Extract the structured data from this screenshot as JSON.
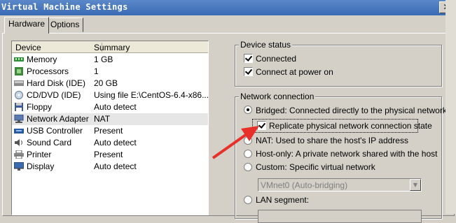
{
  "window": {
    "title": "Virtual Machine Settings",
    "close_label": "✕"
  },
  "tabs": [
    {
      "label": "Hardware",
      "active": true
    },
    {
      "label": "Options",
      "active": false
    }
  ],
  "device_list": {
    "columns": [
      "Device",
      "Summary"
    ],
    "rows": [
      {
        "name": "Memory",
        "summary": "1 GB",
        "icon": "memory-icon"
      },
      {
        "name": "Processors",
        "summary": "1",
        "icon": "processor-icon"
      },
      {
        "name": "Hard Disk (IDE)",
        "summary": "20 GB",
        "icon": "hard-disk-icon"
      },
      {
        "name": "CD/DVD (IDE)",
        "summary": "Using file E:\\CentOS-6.4-x86...",
        "icon": "cd-dvd-icon"
      },
      {
        "name": "Floppy",
        "summary": "Auto detect",
        "icon": "floppy-icon"
      },
      {
        "name": "Network Adapter",
        "summary": "NAT",
        "icon": "network-adapter-icon",
        "selected": true
      },
      {
        "name": "USB Controller",
        "summary": "Present",
        "icon": "usb-icon"
      },
      {
        "name": "Sound Card",
        "summary": "Auto detect",
        "icon": "sound-card-icon"
      },
      {
        "name": "Printer",
        "summary": "Present",
        "icon": "printer-icon"
      },
      {
        "name": "Display",
        "summary": "Auto detect",
        "icon": "display-icon"
      }
    ]
  },
  "device_status": {
    "title": "Device status",
    "connected": {
      "label": "Connected",
      "checked": true
    },
    "connect_at_power_on": {
      "label": "Connect at power on",
      "checked": true
    }
  },
  "network_connection": {
    "title": "Network connection",
    "bridged": {
      "label": "Bridged: Connected directly to the physical network",
      "selected": true
    },
    "replicate": {
      "label": "Replicate physical network connection state",
      "checked": true
    },
    "nat": {
      "label": "NAT: Used to share the host's IP address",
      "selected": false
    },
    "host_only": {
      "label": "Host-only: A private network shared with the host",
      "selected": false
    },
    "custom": {
      "label": "Custom: Specific virtual network",
      "selected": false
    },
    "custom_network_value": "VMnet0 (Auto-bridging)",
    "lan_segment": {
      "label": "LAN segment:",
      "selected": false
    }
  },
  "colors": {
    "title_bar": "#3a6ab4",
    "dialog_bg": "#d4d0c8",
    "annotation_arrow": "#e8302a"
  }
}
